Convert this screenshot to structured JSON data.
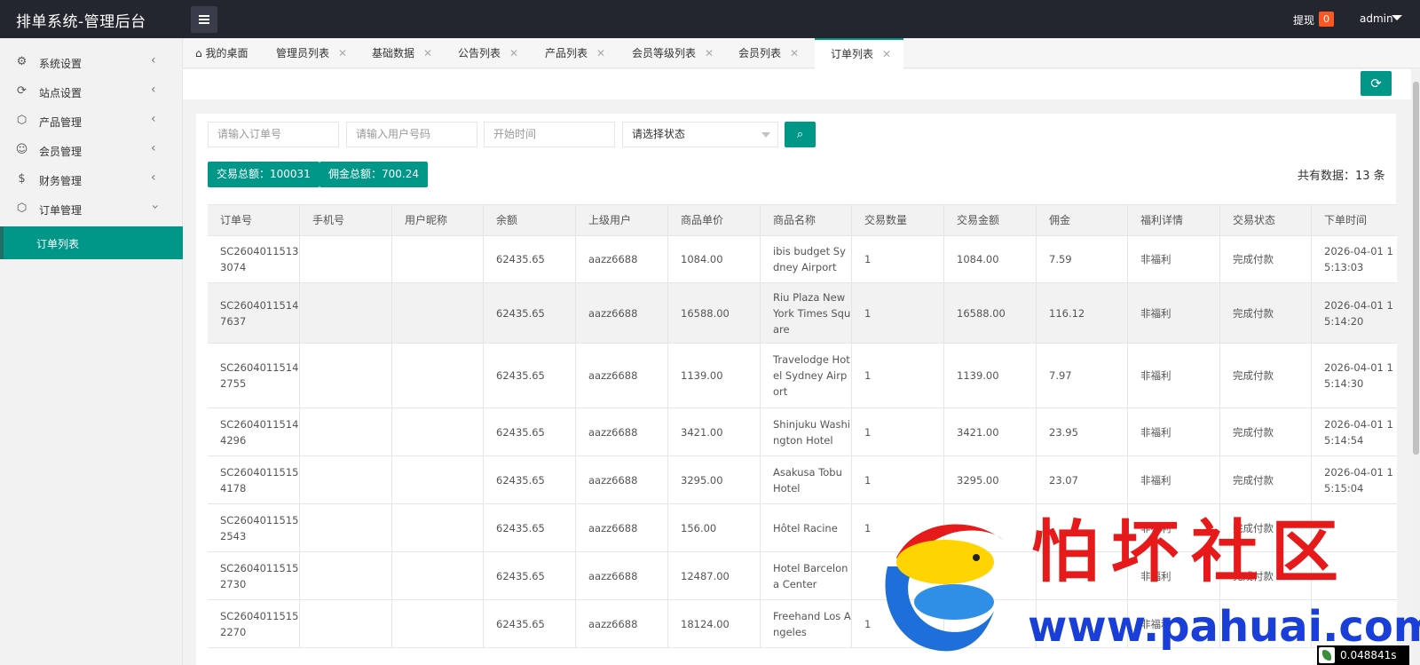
{
  "header": {
    "title": "排单系统-管理后台",
    "withdraw_label": "提现",
    "withdraw_count": "0",
    "user": "admin"
  },
  "sidebar": {
    "items": [
      {
        "label": "系统设置",
        "icon": "gear-icon"
      },
      {
        "label": "站点设置",
        "icon": "cycle-icon"
      },
      {
        "label": "产品管理",
        "icon": "cube-icon"
      },
      {
        "label": "会员管理",
        "icon": "user-icon"
      },
      {
        "label": "财务管理",
        "icon": "dollar-icon"
      },
      {
        "label": "订单管理",
        "icon": "cube-icon"
      }
    ],
    "active_sub": "订单列表"
  },
  "tabs": [
    {
      "label": "我的桌面"
    },
    {
      "label": "管理员列表"
    },
    {
      "label": "基础数据"
    },
    {
      "label": "公告列表"
    },
    {
      "label": "产品列表"
    },
    {
      "label": "会员等级列表"
    },
    {
      "label": "会员列表"
    },
    {
      "label": "订单列表"
    }
  ],
  "filters": {
    "order_placeholder": "请输入订单号",
    "phone_placeholder": "请输入用户号码",
    "start_placeholder": "开始时间",
    "status_value": "请选择状态"
  },
  "stats": {
    "trade_total": "交易总额：100031",
    "commission_total": "佣金总额：700.24",
    "record_count": "共有数据：13 条"
  },
  "table": {
    "headers": [
      "订单号",
      "手机号",
      "用户昵称",
      "余额",
      "上级用户",
      "商品单价",
      "商品名称",
      "交易数量",
      "交易金额",
      "佣金",
      "福利详情",
      "交易状态",
      "下单时间"
    ],
    "rows": [
      [
        "SC26040115133074",
        "",
        "",
        "62435.65",
        "aazz6688",
        "1084.00",
        "ibis budget Sydney Airport",
        "1",
        "1084.00",
        "7.59",
        "非福利",
        "完成付款",
        "2026-04-01 15:13:03"
      ],
      [
        "SC26040115147637",
        "",
        "",
        "62435.65",
        "aazz6688",
        "16588.00",
        "Riu Plaza New York Times Square",
        "1",
        "16588.00",
        "116.12",
        "非福利",
        "完成付款",
        "2026-04-01 15:14:20"
      ],
      [
        "SC26040115142755",
        "",
        "",
        "62435.65",
        "aazz6688",
        "1139.00",
        "Travelodge Hotel Sydney Airport",
        "1",
        "1139.00",
        "7.97",
        "非福利",
        "完成付款",
        "2026-04-01 15:14:30"
      ],
      [
        "SC26040115144296",
        "",
        "",
        "62435.65",
        "aazz6688",
        "3421.00",
        "Shinjuku Washington Hotel",
        "1",
        "3421.00",
        "23.95",
        "非福利",
        "完成付款",
        "2026-04-01 15:14:54"
      ],
      [
        "SC26040115154178",
        "",
        "",
        "62435.65",
        "aazz6688",
        "3295.00",
        "Asakusa Tobu Hotel",
        "1",
        "3295.00",
        "23.07",
        "非福利",
        "完成付款",
        "2026-04-01 15:15:04"
      ],
      [
        "SC26040115152543",
        "",
        "",
        "62435.65",
        "aazz6688",
        "156.00",
        "Hôtel Racine",
        "1",
        "",
        "",
        "非福利",
        "完成付款",
        ""
      ],
      [
        "SC26040115152730",
        "",
        "",
        "62435.65",
        "aazz6688",
        "12487.00",
        "Hotel Barcelona Center",
        "",
        "",
        "",
        "非福利",
        "完成付款",
        ""
      ],
      [
        "SC26040115152270",
        "",
        "",
        "62435.65",
        "aazz6688",
        "18124.00",
        "Freehand Los Angeles",
        "1",
        "",
        "",
        "非福利",
        "",
        ""
      ]
    ]
  },
  "watermark": {
    "text": "怕坏社区",
    "url": "www.pahuai.com"
  },
  "timer": "0.048841s",
  "colors": {
    "accent": "#009688",
    "topbar": "#23262e",
    "badge": "#ff5722"
  }
}
